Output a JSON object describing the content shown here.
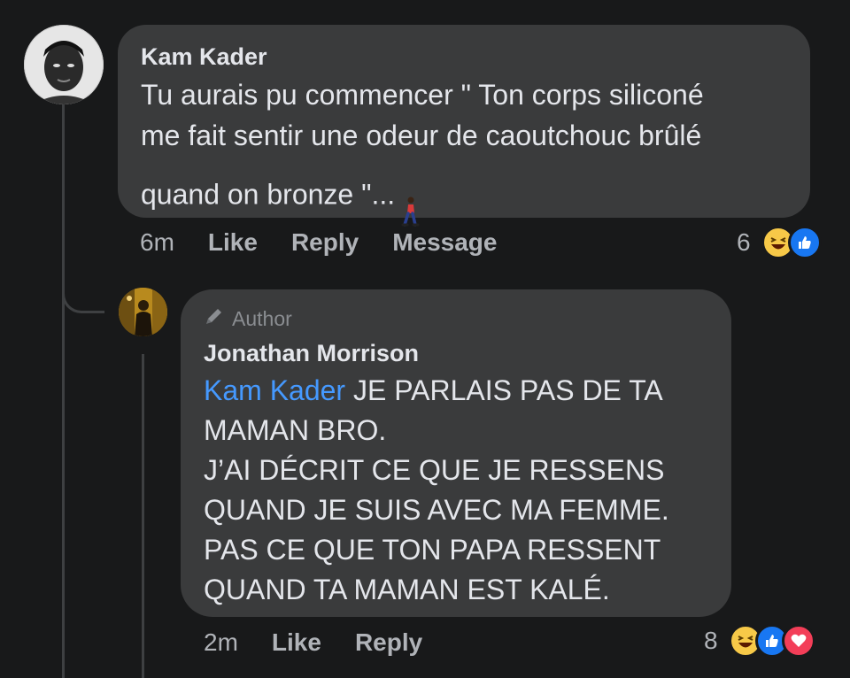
{
  "comment": {
    "author": "Kam Kader",
    "text": "Tu aurais pu commencer \" Ton corps siliconé\nme fait sentir une odeur de caoutchouc brûlé\nquand on bronze \"...",
    "time": "6m",
    "like_label": "Like",
    "reply_label": "Reply",
    "message_label": "Message",
    "reaction_count": "6",
    "reactions": [
      "haha",
      "like"
    ],
    "trailing_icon": "person-walking-icon"
  },
  "reply": {
    "badge_label": "Author",
    "author": "Jonathan Morrison",
    "mention": "Kam Kader",
    "text_first": " JE PARLAIS PAS DE TA\nMAMAN BRO.\nJ’AI DÉCRIT CE QUE JE RESSENS\nQUAND JE SUIS AVEC MA FEMME.\nPAS CE QUE TON PAPA RESSENT\nQUAND TA MAMAN EST KALÉ.",
    "time": "2m",
    "like_label": "Like",
    "reply_label": "Reply",
    "reaction_count": "8",
    "reactions": [
      "haha",
      "like",
      "love"
    ]
  },
  "colors": {
    "background": "#18191a",
    "bubble": "#3a3b3c",
    "mention": "#4599ff",
    "secondary_text": "#b0b3b8"
  }
}
